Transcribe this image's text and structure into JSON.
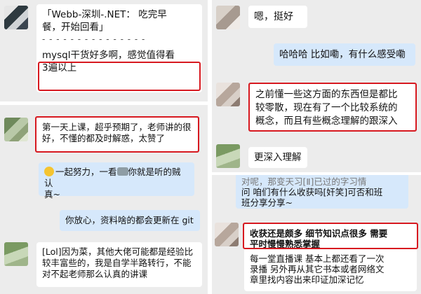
{
  "panel1": {
    "quote_lines": [
      "「Webb-深圳-.NET： 吃完早",
      "餐，开始回看」"
    ],
    "dashes": "- - - - - - - - - - - - - - -",
    "message": [
      "mysql干货好多啊，感觉值得看",
      "3遍以上"
    ]
  },
  "panel2": {
    "msg1": [
      "第一天上课，超乎预期了，老师讲的很",
      "好，不懂的都及时解惑，太赞了"
    ],
    "msg2_pre": "一起努力，一看",
    "msg2_post": "你就是听的贼认",
    "msg2_line2": "真~",
    "msg3": "你放心，资料啥的都会更新在 git",
    "msg4": [
      "[Lol]因为菜，其他大佬可能都是经验比",
      "较丰富些的，我是自学半路转行，不能",
      "对不起老师那么认真的讲课"
    ]
  },
  "panel3": {
    "msg1": "嗯，挺好",
    "msg2": "哈哈哈 比如嘞，有什么感受嘞",
    "msg3": [
      "之前懂一些这方面的东西但是都比",
      "较零散，现在有了一个比较系统的",
      "概念，而且有些概念理解的跟深入"
    ],
    "msg4": "更深入理解"
  },
  "panel4": {
    "top_lines": [
      "对呢，那变天习[Ⅱ]已过的字习情",
      "问 咱们有什么收获吗[奸笑]可否和班",
      "班分享分享~"
    ],
    "highlight": [
      "收获还是颇多 细节知识点很多 需要",
      "平时慢慢熟悉掌握"
    ],
    "bottom_lines": [
      "每一堂直播课 基本上都还看了一次",
      "录播  另外再从其它书本或者网络文",
      "章里找内容出来印证加深记忆"
    ]
  }
}
